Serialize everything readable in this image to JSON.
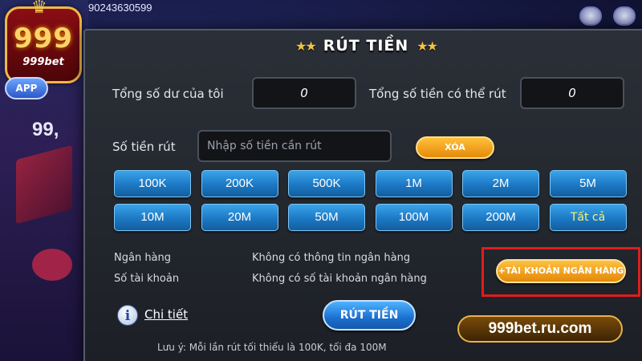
{
  "background": {
    "phone": "90243630599",
    "side_number": "99,",
    "app_badge": "APP"
  },
  "logo": {
    "number": "999",
    "brand": "999bet"
  },
  "dialog": {
    "title": "RÚT TIỀN",
    "balance_label": "Tổng số dư của tôi",
    "balance_value": "0",
    "withdrawable_label": "Tổng số tiền có thể rút",
    "withdrawable_value": "0",
    "amount_label": "Số tiền rút",
    "amount_placeholder": "Nhập số tiền cần rút",
    "clear_button": "XÓA",
    "amounts": [
      "100K",
      "200K",
      "500K",
      "1M",
      "2M",
      "5M",
      "10M",
      "20M",
      "50M",
      "100M",
      "200M",
      "Tất cả"
    ],
    "bank_label": "Ngân hàng",
    "bank_value": "Không có thông tin ngân hàng",
    "account_label": "Số tài khoản",
    "account_value": "Không có số tài khoản ngân hàng",
    "add_bank_button": "+TÀI KHOẢN NGÂN HÀNG",
    "detail_link": "Chi tiết",
    "withdraw_button": "RÚT TIỀN",
    "note": "Lưu ý: Mỗi lần rút tối thiểu là 100K, tối đa 100M"
  },
  "watermark": "999bet.ru.com",
  "colors": {
    "highlight": "#e11c1c",
    "amount_button": "#1c78c4",
    "gold_button": "#f0a81e"
  }
}
